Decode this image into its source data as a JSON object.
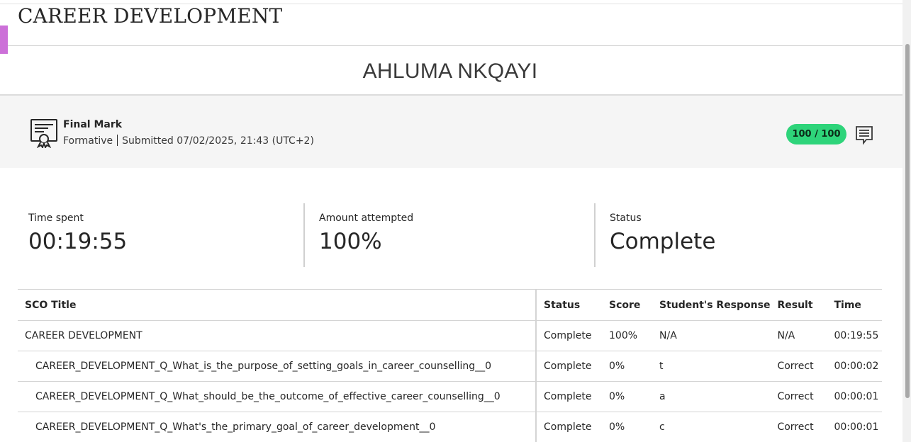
{
  "course": {
    "title": "CAREER DEVELOPMENT"
  },
  "student": {
    "name": "AHLUMA NKQAYI"
  },
  "grade": {
    "title": "Final Mark",
    "type": "Formative",
    "submitted": "Submitted 07/02/2025, 21:43 (UTC+2)",
    "score": "100 / 100",
    "pill_color": "#2ed47a"
  },
  "stats": {
    "time_spent": {
      "label": "Time spent",
      "value": "00:19:55"
    },
    "amount_attempted": {
      "label": "Amount attempted",
      "value": "100%"
    },
    "status": {
      "label": "Status",
      "value": "Complete"
    }
  },
  "table": {
    "headers": [
      "SCO Title",
      "Status",
      "Score",
      "Student's Response",
      "Result",
      "Time"
    ],
    "rows": [
      [
        "CAREER DEVELOPMENT",
        "Complete",
        "100%",
        "N/A",
        "N/A",
        "00:19:55"
      ],
      [
        "CAREER_DEVELOPMENT_Q_What_is_the_purpose_of_setting_goals_in_career_counselling__0",
        "Complete",
        "0%",
        "t",
        "Correct",
        "00:00:02"
      ],
      [
        "CAREER_DEVELOPMENT_Q_What_should_be_the_outcome_of_effective_career_counselling__0",
        "Complete",
        "0%",
        "a",
        "Correct",
        "00:00:01"
      ],
      [
        "CAREER_DEVELOPMENT_Q_What's_the_primary_goal_of_career_development__0",
        "Complete",
        "0%",
        "c",
        "Correct",
        "00:00:01"
      ]
    ]
  },
  "icons": {
    "grade_item": "certificate-icon",
    "feedback": "feedback-icon"
  }
}
